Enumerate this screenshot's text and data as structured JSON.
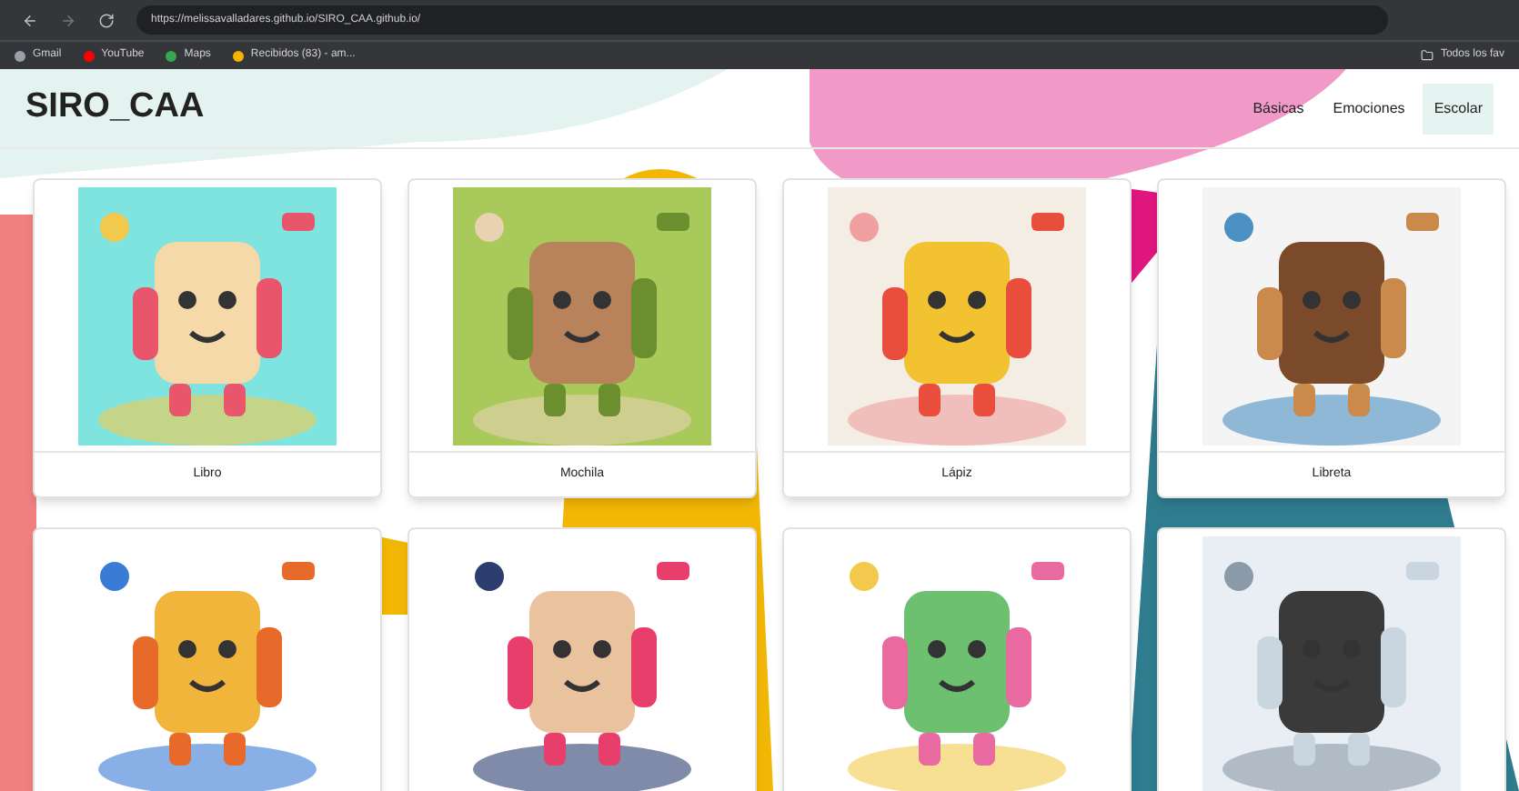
{
  "browser": {
    "url": "https://melissavalladares.github.io/SIRO_CAA.github.io/",
    "bookmarks": [
      {
        "label": "Gmail",
        "color": "#9aa0a6"
      },
      {
        "label": "YouTube",
        "color": "#ff0000"
      },
      {
        "label": "Maps",
        "color": "#34a853"
      },
      {
        "label": "Recibidos (83) - am...",
        "color": "#f4b400"
      }
    ],
    "all_bookmarks": "Todos los fav"
  },
  "header": {
    "title": "SIRO_CAA",
    "nav": [
      {
        "label": "Básicas",
        "selected": false
      },
      {
        "label": "Emociones",
        "selected": false
      },
      {
        "label": "Escolar",
        "selected": true
      }
    ]
  },
  "cards": [
    {
      "kind": "picture",
      "label": "Libro"
    },
    {
      "kind": "picture",
      "label": "Mochila"
    },
    {
      "kind": "picture",
      "label": "Lápiz"
    },
    {
      "kind": "picture",
      "label": "Libreta"
    },
    {
      "kind": "picture"
    },
    {
      "kind": "picture"
    },
    {
      "kind": "picture"
    },
    {
      "kind": "picture"
    }
  ]
}
